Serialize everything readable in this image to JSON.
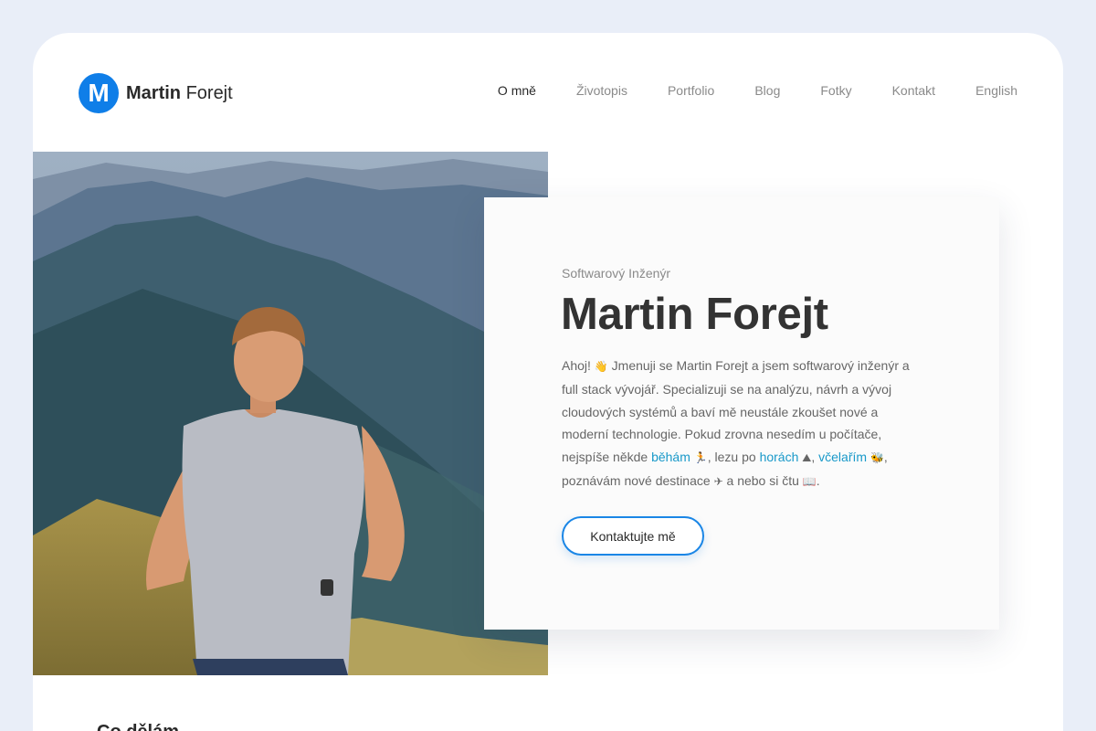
{
  "logo": {
    "letter": "M",
    "first": "Martin",
    "last": "Forejt"
  },
  "nav": [
    {
      "label": "O mně",
      "active": true
    },
    {
      "label": "Životopis"
    },
    {
      "label": "Portfolio"
    },
    {
      "label": "Blog"
    },
    {
      "label": "Fotky"
    },
    {
      "label": "Kontakt"
    },
    {
      "label": "English"
    }
  ],
  "hero": {
    "subtitle": "Softwarový Inženýr",
    "name": "Martin Forejt",
    "bio": {
      "p1": "Ahoj! ",
      "wave": "👋",
      "p2": " Jmenuji se Martin Forejt a jsem softwarový inženýr a full stack vývojář. Specializuji se na analýzu, návrh a vývoj cloudových systémů a baví mě neustále zkoušet nové a moderní technologie. Pokud zrovna nesedím u počítače, nejspíše někde ",
      "link_running": "běhám",
      "runner": "🏃",
      "p3": ", lezu po ",
      "link_mountains": "horách",
      "mountain": "⛰",
      "p4": ", ",
      "link_bees": "včelařím",
      "bee": "🐝",
      "p5": ", poznávám nové destinace ",
      "plane": "✈",
      "p6": " a nebo si čtu ",
      "book": "📖",
      "p7": "."
    },
    "cta": "Kontaktujte mě"
  },
  "section": {
    "title": "Co dělám"
  },
  "colors": {
    "accent": "#0f7ee8",
    "link": "#1999c9",
    "background": "#e9eef8"
  }
}
